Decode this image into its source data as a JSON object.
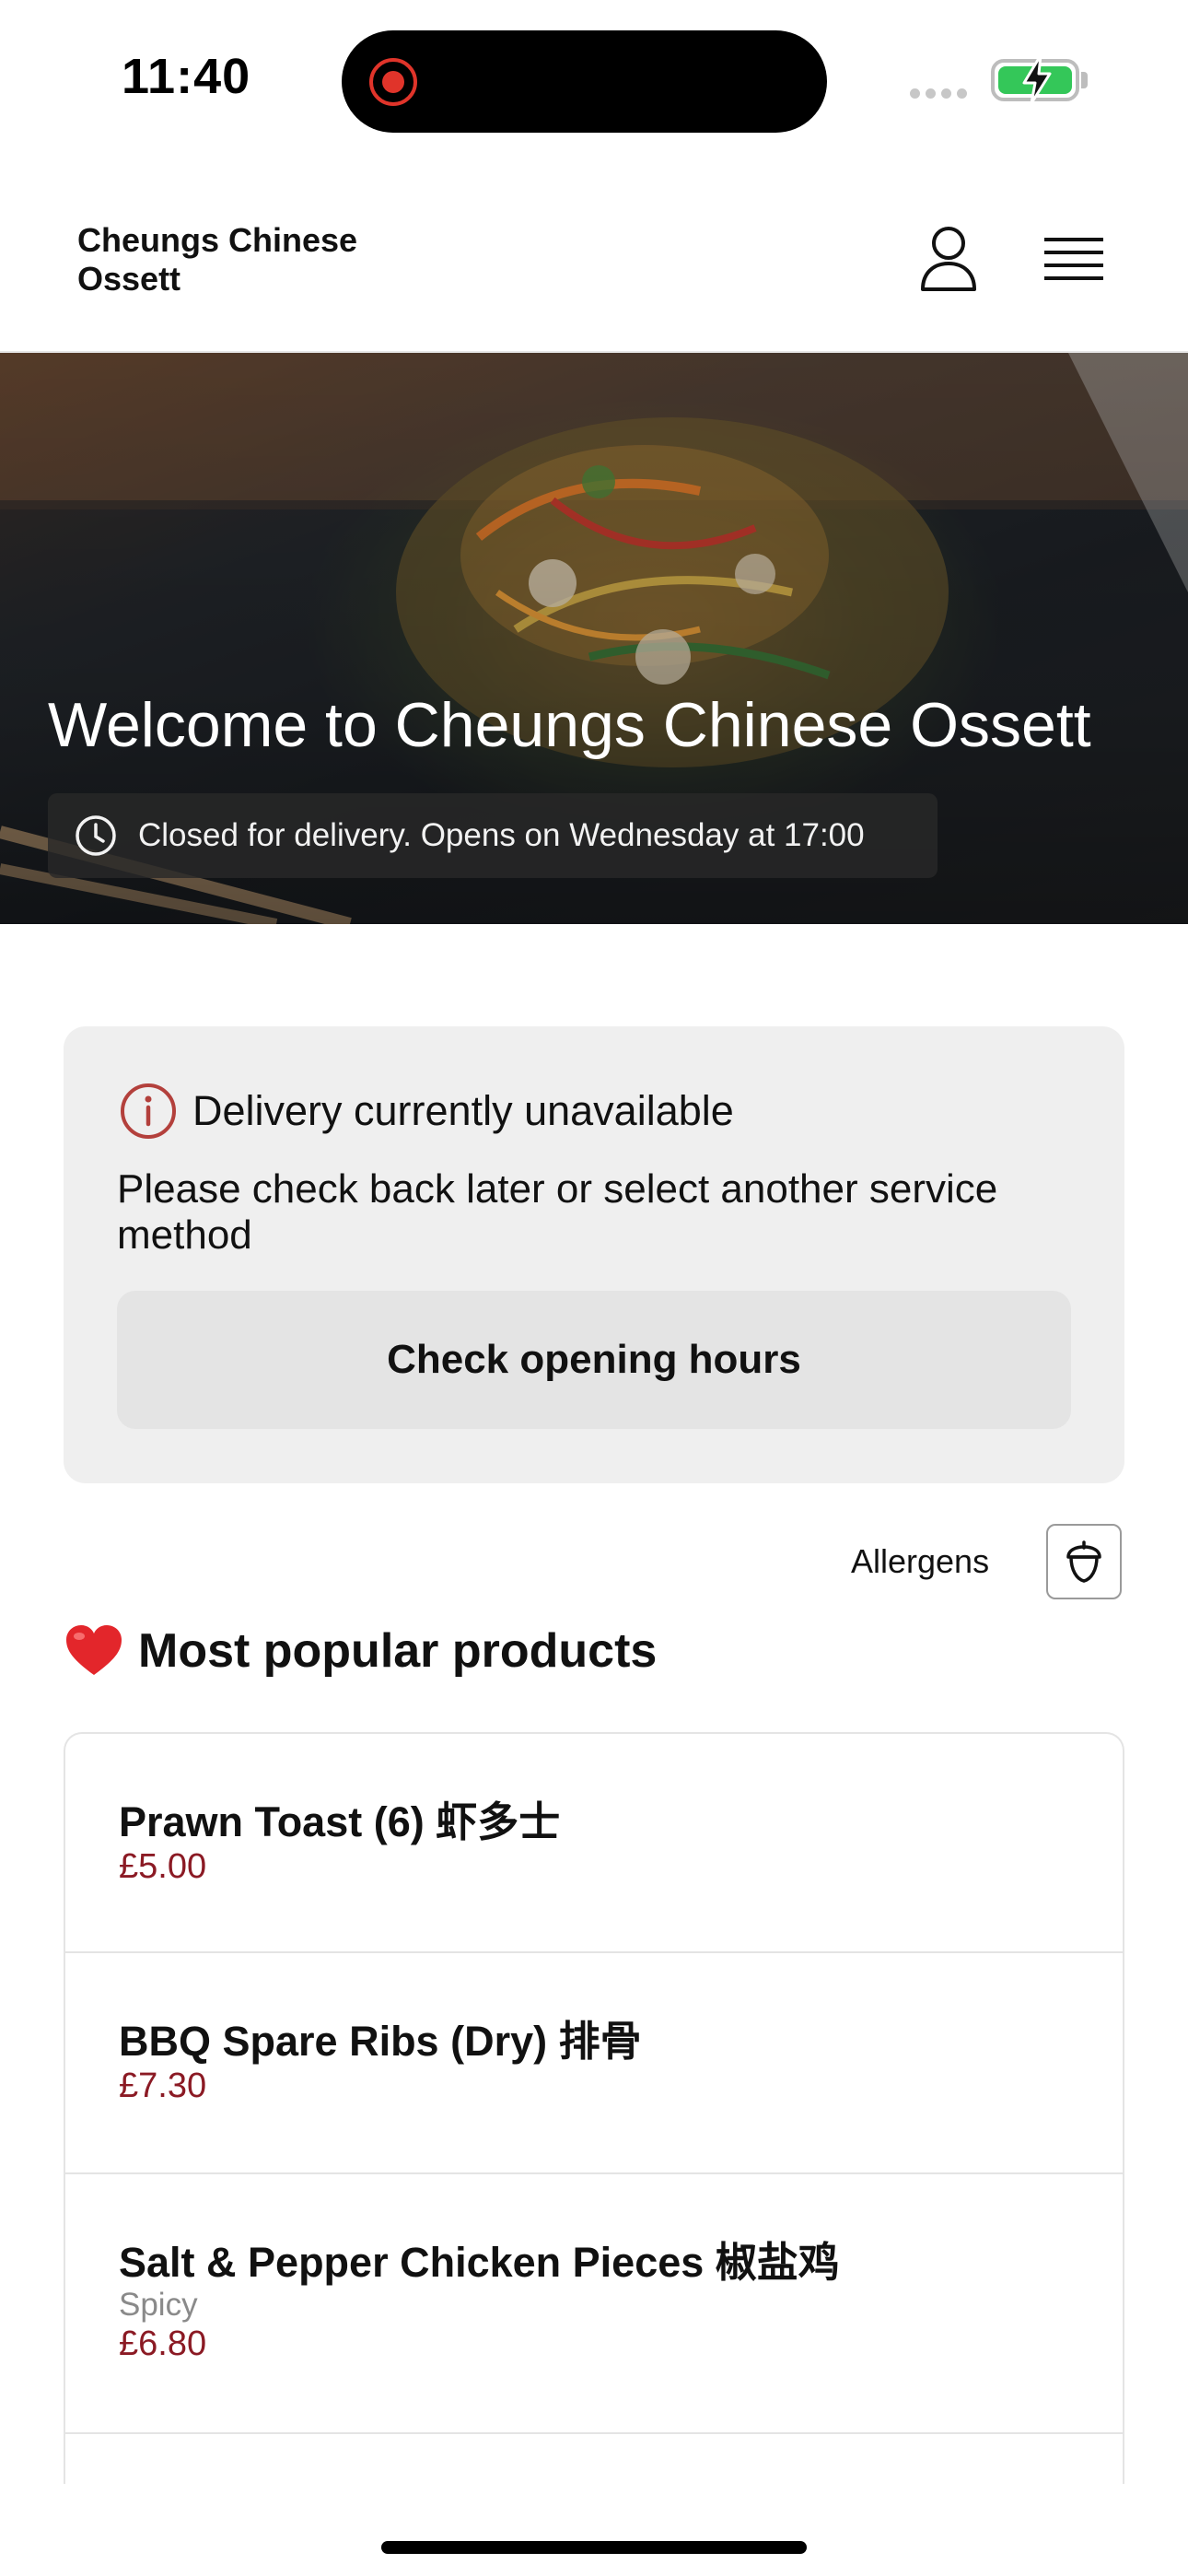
{
  "status_bar": {
    "time": "11:40"
  },
  "header": {
    "brand_line1": "Cheungs Chinese",
    "brand_line2": "Ossett"
  },
  "hero": {
    "title": "Welcome to Cheungs Chinese Ossett",
    "status": "Closed for delivery. Opens on Wednesday at 17:00"
  },
  "notice": {
    "title": "Delivery currently unavailable",
    "body": "Please check back later or select another service method",
    "button_label": "Check opening hours"
  },
  "allergens": {
    "label": "Allergens"
  },
  "popular": {
    "emoji": "❤️",
    "title": "Most popular products"
  },
  "products": [
    {
      "name": "Prawn Toast (6) 虾多士",
      "tag": "",
      "price": "£5.00"
    },
    {
      "name": "BBQ Spare Ribs (Dry) 排骨",
      "tag": "",
      "price": "£7.30"
    },
    {
      "name": "Salt & Pepper Chicken Pieces 椒盐鸡",
      "tag": "Spicy",
      "price": "£6.80"
    }
  ],
  "colors": {
    "price": "#8b1a24",
    "alert_icon": "#b3403c",
    "battery": "#34c759",
    "record": "#e0342a"
  },
  "icons": {
    "record": "record-icon",
    "battery": "battery-charging-icon",
    "user": "user-icon",
    "menu": "hamburger-menu-icon",
    "clock": "clock-icon",
    "alert": "info-circle-icon",
    "allergens": "acorn-icon",
    "heart": "heart-icon"
  }
}
